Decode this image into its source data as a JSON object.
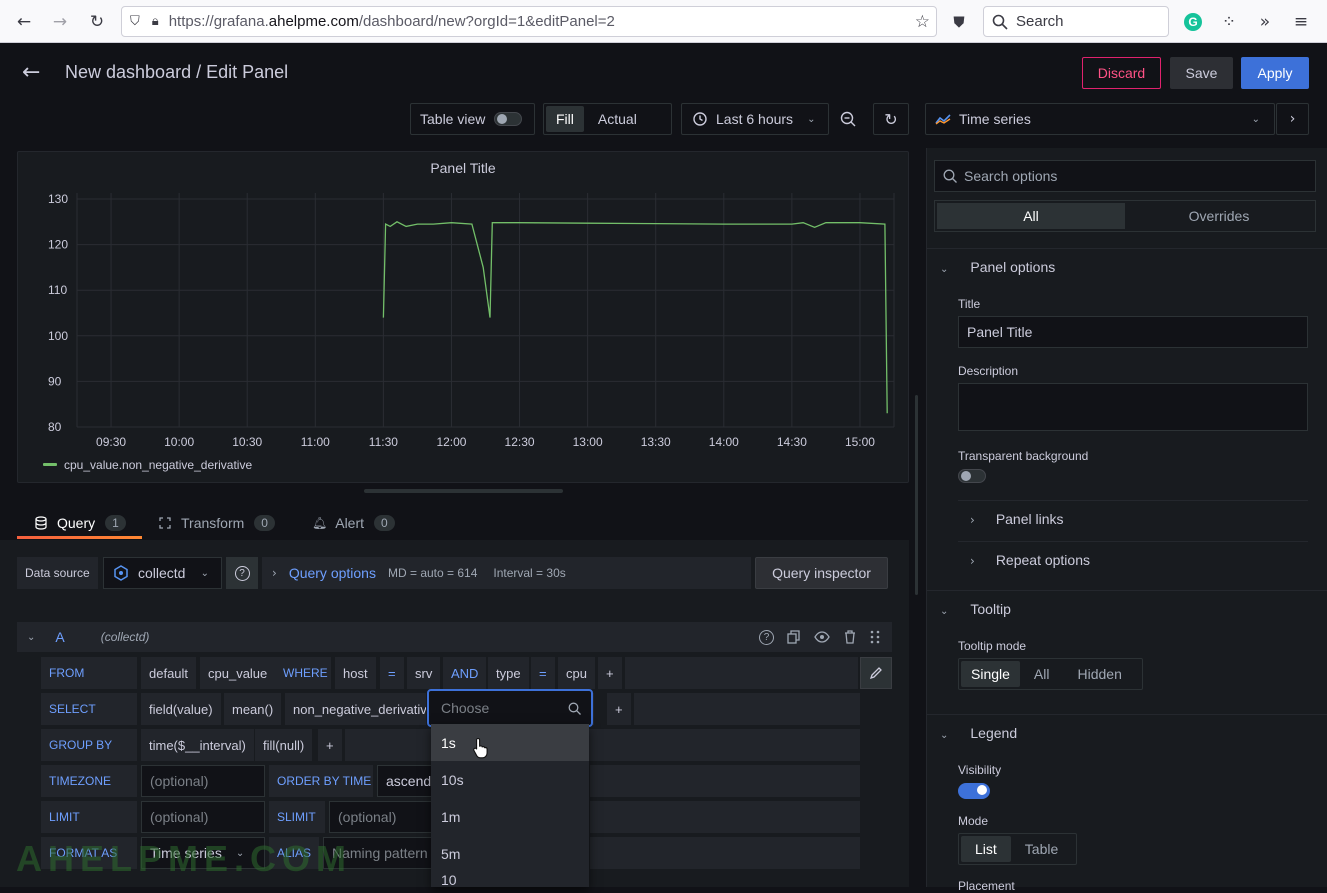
{
  "browser": {
    "url_prefix": "https://grafana.",
    "url_domain": "ahelpme.com",
    "url_path": "/dashboard/new?orgId=1&editPanel=2",
    "search_placeholder": "Search"
  },
  "header": {
    "title": "New dashboard / Edit Panel",
    "discard": "Discard",
    "save": "Save",
    "apply": "Apply"
  },
  "toolbar": {
    "table_view": "Table view",
    "fill": "Fill",
    "actual": "Actual",
    "time_range": "Last 6 hours",
    "viz_type": "Time series"
  },
  "chart_data": {
    "type": "line",
    "title": "Panel Title",
    "x_ticks": [
      "09:30",
      "10:00",
      "10:30",
      "11:00",
      "11:30",
      "12:00",
      "12:30",
      "13:00",
      "13:30",
      "14:00",
      "14:30",
      "15:00"
    ],
    "y_ticks": [
      "130",
      "120",
      "110",
      "100",
      "90",
      "80"
    ],
    "ylim": [
      80,
      130
    ],
    "series": [
      {
        "name": "cpu_value.non_negative_derivative",
        "color": "#73bf69",
        "points": [
          [
            "11:30",
            104
          ],
          [
            "11:31",
            124.5
          ],
          [
            "11:33",
            124
          ],
          [
            "11:36",
            125
          ],
          [
            "11:40",
            124
          ],
          [
            "11:45",
            124.5
          ],
          [
            "11:52",
            124.5
          ],
          [
            "12:00",
            124.8
          ],
          [
            "12:09",
            124.5
          ],
          [
            "12:14",
            115
          ],
          [
            "12:17",
            104
          ],
          [
            "12:18",
            124.8
          ],
          [
            "12:30",
            124.8
          ],
          [
            "13:00",
            124.7
          ],
          [
            "13:30",
            124.6
          ],
          [
            "14:00",
            124.5
          ],
          [
            "14:30",
            124.5
          ],
          [
            "14:35",
            124.8
          ],
          [
            "14:40",
            123.8
          ],
          [
            "14:45",
            124.8
          ],
          [
            "15:00",
            124.8
          ],
          [
            "15:11",
            124.5
          ],
          [
            "15:12",
            83
          ]
        ]
      }
    ],
    "grid": true,
    "legend": "bottom-left"
  },
  "tabs": [
    {
      "label": "Query",
      "count": "1"
    },
    {
      "label": "Transform",
      "count": "0"
    },
    {
      "label": "Alert",
      "count": "0"
    }
  ],
  "query": {
    "data_source_label": "Data source",
    "data_source": "collectd",
    "query_options": "Query options",
    "md": "MD = auto = 614",
    "interval": "Interval = 30s",
    "inspector": "Query inspector",
    "ref": "A",
    "ref_source": "(collectd)",
    "from_label": "FROM",
    "from_policy": "default",
    "from_measurement": "cpu_value",
    "where_label": "WHERE",
    "where_host": "host",
    "eq": "=",
    "where_srv": "srv",
    "and": "AND",
    "where_type": "type",
    "where_cpu": "cpu",
    "plus": "+",
    "select_label": "SELECT",
    "select_field": "field(value)",
    "select_mean": "mean()",
    "select_nnd": "non_negative_derivative",
    "groupby_label": "GROUP BY",
    "groupby_time": "time($__interval)",
    "groupby_fill": "fill(null)",
    "timezone_label": "TIMEZONE",
    "optional": "(optional)",
    "orderby_label": "ORDER BY TIME",
    "orderby_value": "ascend",
    "limit_label": "LIMIT",
    "slimit_label": "SLIMIT",
    "format_label": "FORMAT AS",
    "format_value": "Time series",
    "alias_label": "ALIAS",
    "alias_placeholder": "Naming pattern"
  },
  "dropdown": {
    "placeholder": "Choose",
    "options": [
      "1s",
      "10s",
      "1m",
      "5m",
      "10"
    ]
  },
  "options": {
    "search_placeholder": "Search options",
    "all": "All",
    "overrides": "Overrides",
    "panel_options": "Panel options",
    "title_label": "Title",
    "title_value": "Panel Title",
    "description_label": "Description",
    "transparent_label": "Transparent background",
    "panel_links": "Panel links",
    "repeat_options": "Repeat options",
    "tooltip": "Tooltip",
    "tooltip_mode_label": "Tooltip mode",
    "tooltip_modes": [
      "Single",
      "All",
      "Hidden"
    ],
    "legend": "Legend",
    "visibility_label": "Visibility",
    "mode_label": "Mode",
    "legend_modes": [
      "List",
      "Table"
    ],
    "placement_label": "Placement"
  },
  "watermark": "AHELPME.COM"
}
